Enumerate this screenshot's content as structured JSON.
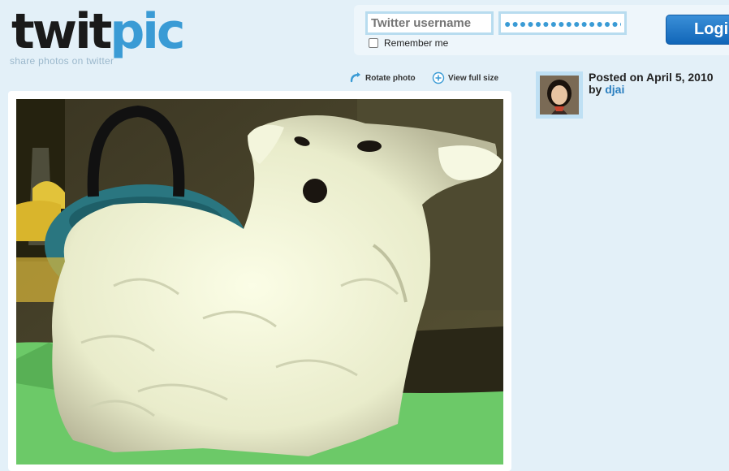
{
  "site": {
    "logo_primary": "twit",
    "logo_secondary": "pic",
    "tagline": "share photos on twitter"
  },
  "login": {
    "username_placeholder": "Twitter username",
    "password_value": "●●●●●●●●●●●●●●●●",
    "remember_label": "Remember me",
    "remember_checked": false,
    "login_label": "Login"
  },
  "photo_actions": {
    "rotate_label": "Rotate photo",
    "fullsize_label": "View full size"
  },
  "post": {
    "posted_text": "Posted on April 5, 2010",
    "by_prefix": "by",
    "author": "djai"
  },
  "colors": {
    "background": "#e3f0f8",
    "brand_blue": "#3a9bd5",
    "link": "#2b7fc0",
    "button": "#1166b8"
  }
}
